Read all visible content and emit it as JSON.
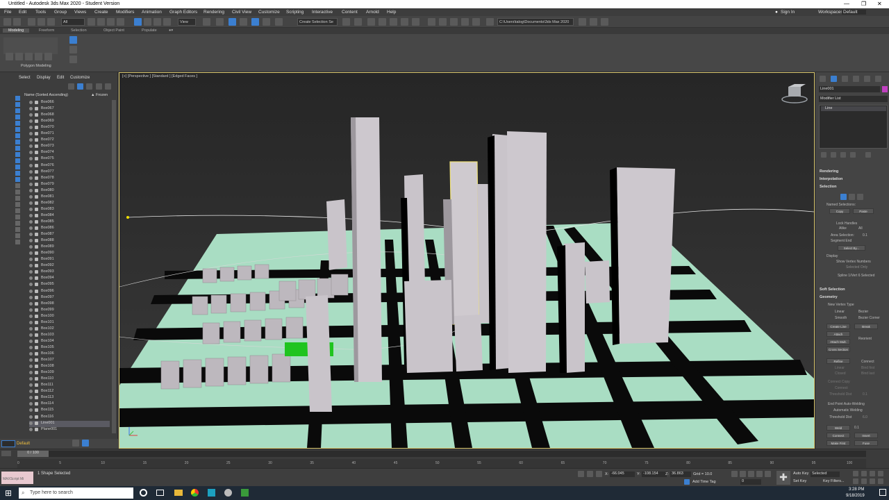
{
  "window": {
    "title": "Untitled - Autodesk 3ds Max 2020 - Student Version",
    "controls": [
      "—",
      "❐",
      "✕"
    ]
  },
  "menu": [
    "File",
    "Edit",
    "Tools",
    "Group",
    "Views",
    "Create",
    "Modifiers",
    "Animation",
    "Graph Editors",
    "Rendering",
    "Civil View",
    "Customize",
    "Scripting",
    "Interactive",
    "Content",
    "Arnold",
    "Help"
  ],
  "account": {
    "sign_in": "Sign In",
    "workspaces_label": "Workspaces:",
    "workspace": "Default"
  },
  "toolbar": {
    "selection_filter": "All",
    "view_dropdown": "View",
    "selection_set": "Create Selection Se",
    "project_path": "C:\\Users\\talog\\Documents\\3ds Max 2020"
  },
  "ribbon_tabs": [
    "Modeling",
    "Freeform",
    "Selection",
    "Object Paint",
    "Populate"
  ],
  "ribbon_panel_label": "Polygon Modeling",
  "scene_explorer": {
    "tabs": [
      "Select",
      "Display",
      "Edit",
      "Customize"
    ],
    "column_header": "Name (Sorted Ascending)",
    "frozen_header": "▲ Frozen",
    "objects": [
      "Box066",
      "Box067",
      "Box068",
      "Box069",
      "Box070",
      "Box071",
      "Box072",
      "Box073",
      "Box074",
      "Box075",
      "Box076",
      "Box077",
      "Box078",
      "Box079",
      "Box080",
      "Box081",
      "Box082",
      "Box083",
      "Box084",
      "Box085",
      "Box086",
      "Box087",
      "Box088",
      "Box089",
      "Box090",
      "Box091",
      "Box092",
      "Box093",
      "Box094",
      "Box095",
      "Box096",
      "Box097",
      "Box098",
      "Box099",
      "Box100",
      "Box101",
      "Box102",
      "Box103",
      "Box104",
      "Box105",
      "Box106",
      "Box107",
      "Box108",
      "Box109",
      "Box110",
      "Box111",
      "Box112",
      "Box113",
      "Box114",
      "Box115",
      "Box116",
      "Line001",
      "Plane001"
    ],
    "selected_object": "Line001",
    "layer": "Default"
  },
  "viewport": {
    "label": "[+] [Perspective ] [Standard ] [Edged Faces ]",
    "colors": {
      "ground": "#a9ddc3",
      "roads": "#000000",
      "buildings": "#c7c2c8",
      "selected_outline": "#f0e27a",
      "highlight_green": "#1fc41f"
    }
  },
  "command_panel": {
    "object_name": "Line001",
    "modifier_list": "Modifier List",
    "stack_item": "Line",
    "rollouts": {
      "rendering": "Rendering",
      "interpolation": "Interpolation",
      "selection": "Selection",
      "named_selections": "Named Selections:",
      "copy": "Copy",
      "paste": "Paste",
      "lock_handles": "Lock Handles",
      "alike": "Alike",
      "all": "All",
      "area_selection": "Area Selection:",
      "area_value": "0.1",
      "segment_end": "Segment End",
      "select_by": "Select By...",
      "display": "Display",
      "show_vertex_numbers": "Show Vertex Numbers",
      "selected_only": "Selected Only",
      "selection_status": "Spline 1/Vert 6 Selected",
      "soft_selection": "Soft Selection",
      "geometry": "Geometry",
      "new_vertex_type": "New Vertex Type",
      "linear": "Linear",
      "bezier": "Bezier",
      "smooth": "Smooth",
      "bezier_corner": "Bezier Corner",
      "create_line": "Create Line",
      "break": "Break",
      "attach": "Attach",
      "reorient": "Reorient",
      "attach_mult": "Attach Mult.",
      "cross_section": "Cross Section",
      "refine": "Refine",
      "connect": "Connect",
      "linear2": "Linear",
      "bind_first": "Bind first",
      "closed": "Closed",
      "bind_last": "Bind last",
      "connect_copy": "Connect Copy",
      "connect2": "Connect",
      "threshold_distance": "Threshold Dist",
      "threshold_value": "0.1",
      "end_point_auto_welding": "End Point Auto-Welding",
      "automatic_welding": "Automatic Welding",
      "threshold_dist": "Threshold Dist",
      "threshold_dist_value": "6.0",
      "weld": "Weld",
      "weld_value": "0.1",
      "connect3": "Connect",
      "insert": "Insert",
      "make_first": "Make First",
      "fuse": "Fuse"
    }
  },
  "timeline": {
    "frame_counter": "0 / 100",
    "ticks": [
      "0",
      "5",
      "10",
      "15",
      "20",
      "25",
      "30",
      "35",
      "40",
      "45",
      "50",
      "55",
      "60",
      "65",
      "70",
      "75",
      "80",
      "85",
      "90",
      "95",
      "100"
    ]
  },
  "status": {
    "maxscript": "MAXScript Mi",
    "message": "1 Shape Selected",
    "x_label": "X:",
    "x_value": "-66.045",
    "y_label": "Y:",
    "y_value": "-108.154",
    "z_label": "Z:",
    "z_value": "36.863",
    "grid": "Grid = 10.0",
    "add_time_tag": "Add Time Tag",
    "auto_key": "Auto Key",
    "set_key": "Set Key",
    "selected": "Selected",
    "key_filters": "Key Filters...",
    "frame": "0"
  },
  "taskbar": {
    "search_placeholder": "Type here to search",
    "time": "3:28 PM",
    "date": "9/18/2019"
  }
}
